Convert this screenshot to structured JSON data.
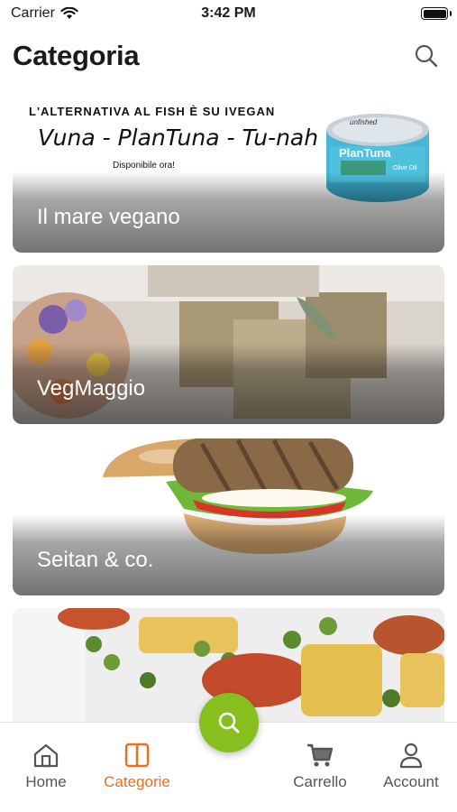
{
  "status_bar": {
    "carrier": "Carrier",
    "time": "3:42 PM"
  },
  "header": {
    "title": "Categoria",
    "search_icon": "search-icon"
  },
  "categories": [
    {
      "label": "Il mare vegano",
      "promo": {
        "line1": "L'ALTERNATIVA AL FISH È SU IVEGAN",
        "line2": "Vuna - PlanTuna - Tu-nah",
        "line3": "Disponibile ora!",
        "can_brand": "unfished",
        "can_product": "PlanTuna",
        "can_variant": "Olive Oil"
      }
    },
    {
      "label": "VegMaggio"
    },
    {
      "label": "Seitan & co."
    },
    {
      "label": ""
    }
  ],
  "fab": {
    "icon": "search-icon",
    "color": "#86bf1e"
  },
  "tab_bar": {
    "active_color": "#f26c1f",
    "tabs": [
      {
        "label": "Home",
        "icon": "home-icon",
        "active": false
      },
      {
        "label": "Categorie",
        "icon": "categories-icon",
        "active": true
      },
      {
        "label": "Carrello",
        "icon": "cart-icon",
        "active": false
      },
      {
        "label": "Account",
        "icon": "account-icon",
        "active": false
      }
    ]
  }
}
